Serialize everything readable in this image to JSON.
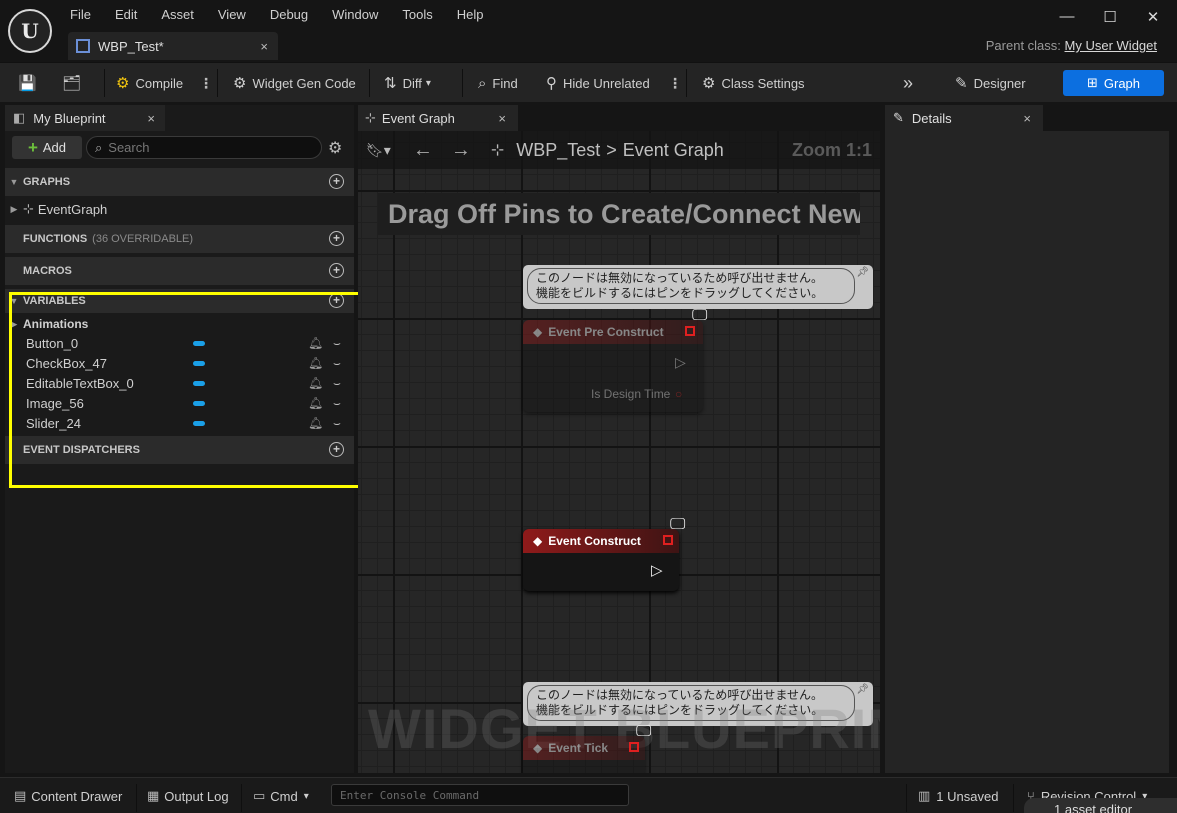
{
  "menu": [
    "File",
    "Edit",
    "Asset",
    "View",
    "Debug",
    "Window",
    "Tools",
    "Help"
  ],
  "document_tab": {
    "label": "WBP_Test*",
    "close": "×"
  },
  "parent_class": {
    "label": "Parent class:",
    "value": "My User Widget"
  },
  "window_controls": {
    "minimize": "—",
    "maximize": "☐",
    "close": "✕"
  },
  "toolbar": {
    "compile": "Compile",
    "widget_gen_code": "Widget Gen Code",
    "diff": "Diff",
    "find": "Find",
    "hide_unrelated": "Hide Unrelated",
    "class_settings": "Class Settings",
    "designer": "Designer",
    "graph": "Graph"
  },
  "my_blueprint": {
    "tab_label": "My Blueprint",
    "add_label": "Add",
    "search_placeholder": "Search",
    "sections": {
      "graphs": "GRAPHS",
      "functions": "FUNCTIONS",
      "functions_sub": "(36 OVERRIDABLE)",
      "macros": "MACROS",
      "variables": "VARIABLES",
      "event_dispatchers": "EVENT DISPATCHERS"
    },
    "graph_items": [
      "EventGraph"
    ],
    "variable_category": "Animations",
    "variables": [
      "Button_0",
      "CheckBox_47",
      "EditableTextBox_0",
      "Image_56",
      "Slider_24"
    ]
  },
  "graph_tab": {
    "label": "Event Graph"
  },
  "graph": {
    "breadcrumb_root": "WBP_Test",
    "breadcrumb_sep": ">",
    "breadcrumb_current": "Event Graph",
    "zoom": "Zoom 1:1",
    "banner": "Drag Off Pins to Create/Connect New Nodes.",
    "watermark": "WIDGET BLUEPRINT",
    "comment_line1": "このノードは無効になっているため呼び出せません。",
    "comment_line2": "機能をビルドするにはピンをドラッグしてください。",
    "nodes": {
      "pre_construct": "Event Pre Construct",
      "is_design_time": "Is Design Time",
      "construct": "Event Construct",
      "tick": "Event Tick"
    }
  },
  "details": {
    "tab_label": "Details"
  },
  "statusbar": {
    "content_drawer": "Content Drawer",
    "output_log": "Output Log",
    "cmd": "Cmd",
    "console_placeholder": "Enter Console Command",
    "unsaved": "1 Unsaved",
    "revision_control": "Revision Control",
    "toast": "1 asset editor"
  },
  "colors": {
    "accent": "#0c6fe0",
    "event_node": "#8f1a1a",
    "variable_pill": "#1ba0e8",
    "highlight": "#ffff00"
  }
}
